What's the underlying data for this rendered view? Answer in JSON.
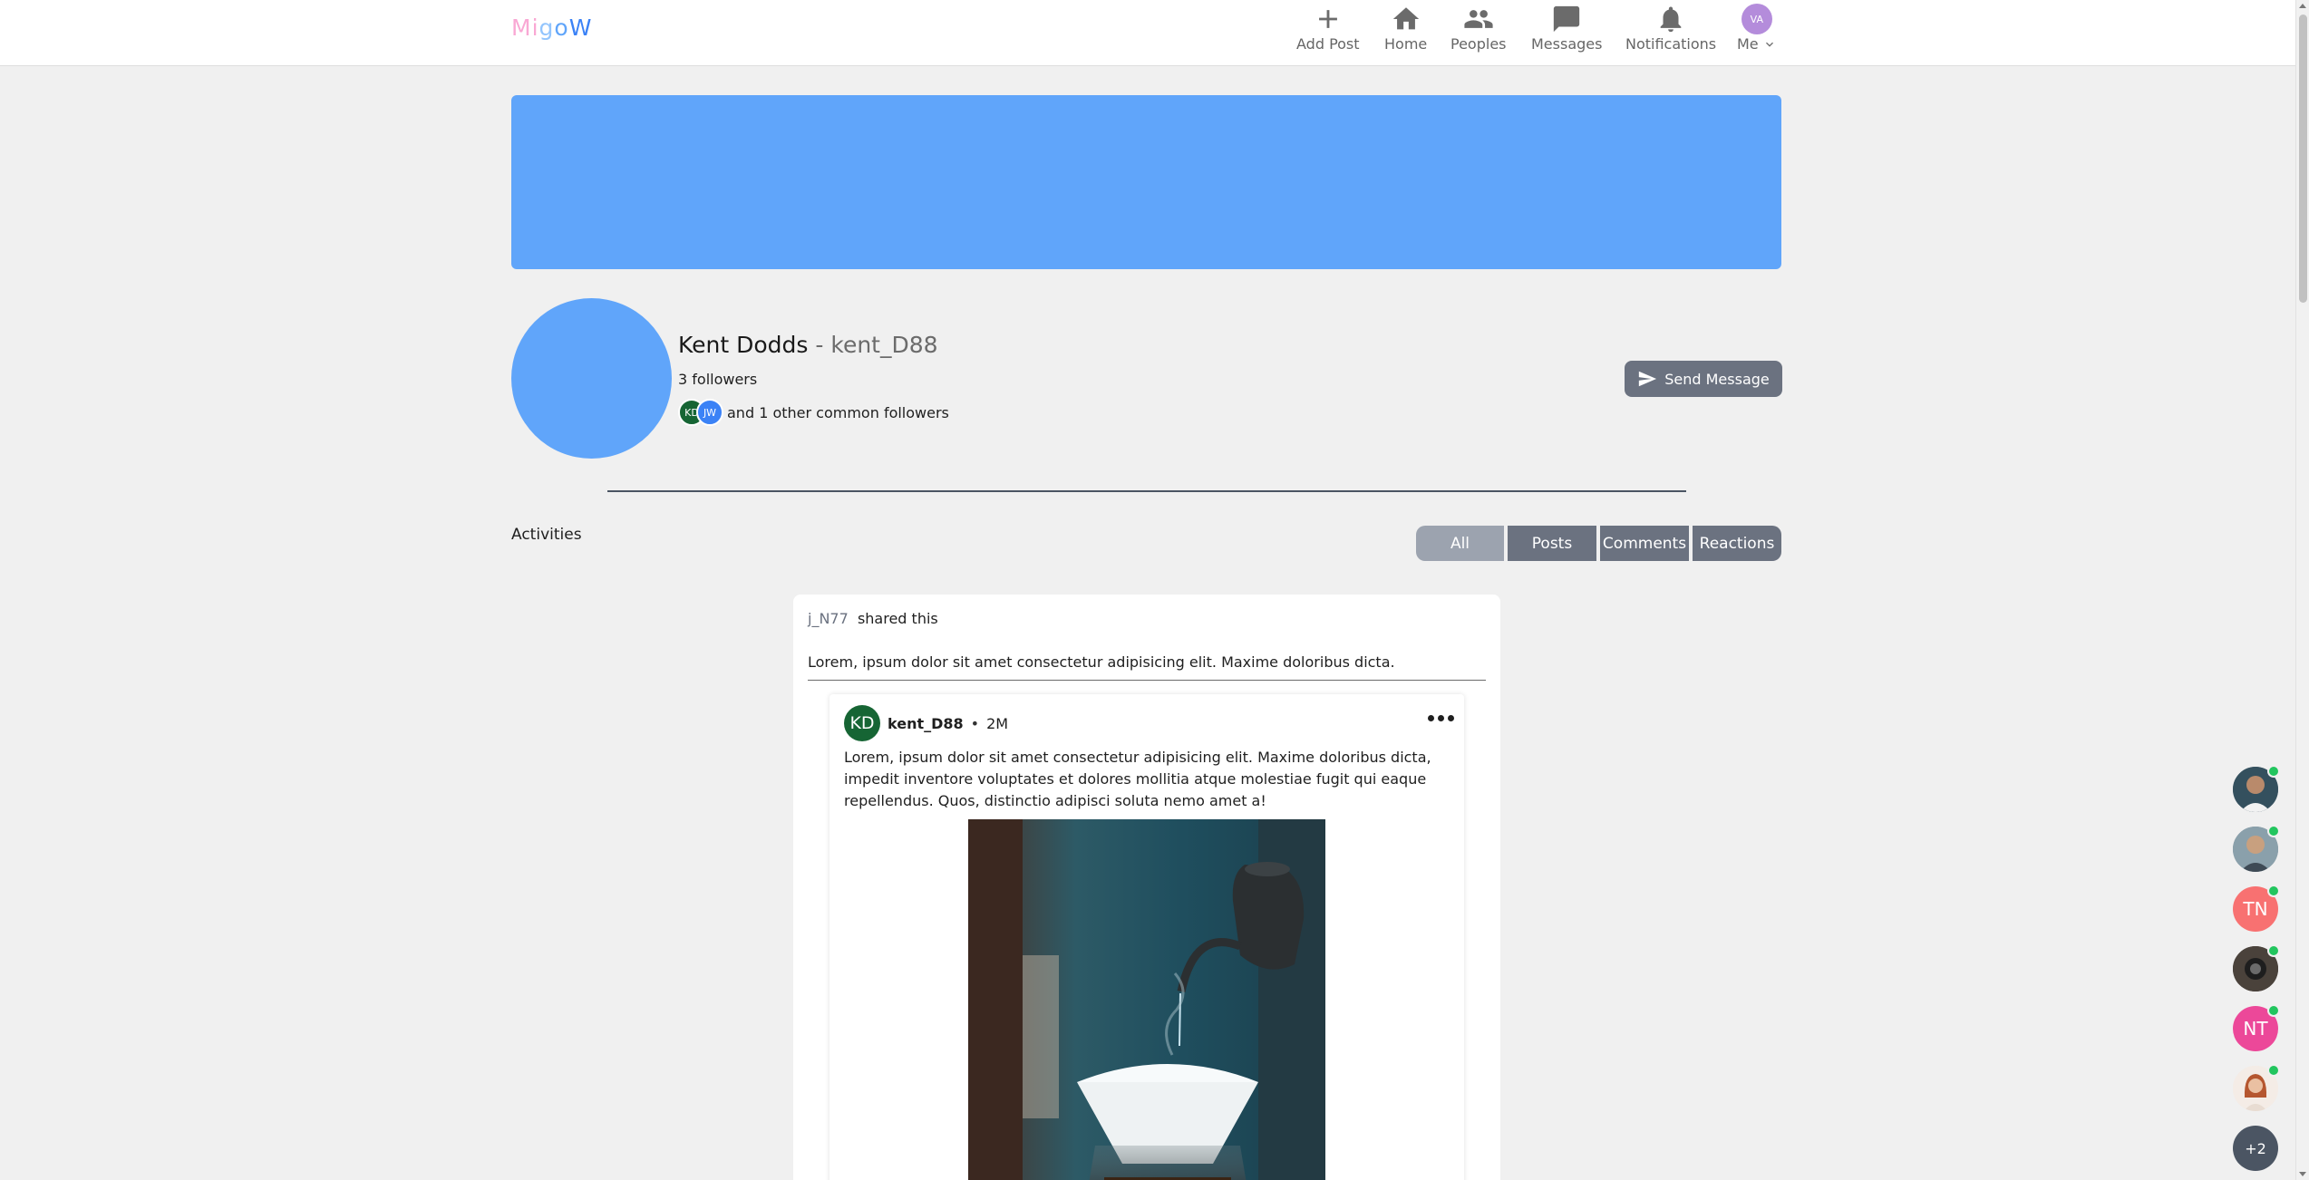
{
  "nav": {
    "logo": "MigoW",
    "items": [
      {
        "label": "Add Post",
        "icon": "plus-icon"
      },
      {
        "label": "Home",
        "icon": "home-icon"
      },
      {
        "label": "Peoples",
        "icon": "people-icon"
      },
      {
        "label": "Messages",
        "icon": "message-icon"
      },
      {
        "label": "Notifications",
        "icon": "bell-icon"
      }
    ],
    "me": {
      "initials": "VA",
      "label": "Me"
    }
  },
  "profile": {
    "name": "Kent Dodds",
    "separator": " - ",
    "username": "kent_D88",
    "followers": "3 followers",
    "common_avatars": [
      "KD",
      "JW"
    ],
    "common_text": "and 1 other common followers",
    "send_message": "Send Message"
  },
  "activities": {
    "label": "Activities",
    "filters": [
      "All",
      "Posts",
      "Comments",
      "Reactions"
    ],
    "active_filter": "All"
  },
  "card": {
    "sharer": "j_N77",
    "shared_text": "shared this",
    "share_caption": "Lorem, ipsum dolor sit amet consectetur adipisicing elit. Maxime doloribus dicta.",
    "post": {
      "avatar": "KD",
      "user": "kent_D88",
      "dot": "•",
      "time": "2M",
      "text": "Lorem, ipsum dolor sit amet consectetur adipisicing elit. Maxime doloribus dicta, impedit inventore voluptates et dolores mollitia atque molestiae fugit qui eaque repellendus. Quos, distinctio adipisci soluta nemo amet a!"
    }
  },
  "online_users": [
    {
      "type": "photo",
      "label": ""
    },
    {
      "type": "photo",
      "label": ""
    },
    {
      "type": "initials",
      "label": "TN",
      "color": "#f87171"
    },
    {
      "type": "photo",
      "label": ""
    },
    {
      "type": "initials",
      "label": "NT",
      "color": "#ec4899"
    },
    {
      "type": "photo",
      "label": ""
    },
    {
      "type": "more",
      "label": "+2",
      "color": "#4b5563"
    }
  ],
  "colors": {
    "accent": "#60a5fa",
    "button": "#6b7280",
    "online": "#22c55e"
  }
}
